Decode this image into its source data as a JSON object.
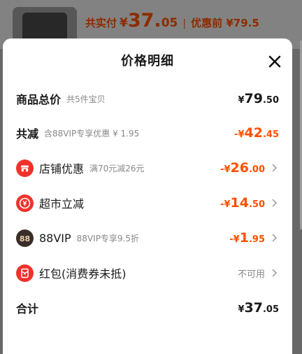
{
  "background": {
    "total_label": "共实付",
    "total_currency": "¥",
    "total_int": "37.",
    "total_dec": "05",
    "separator": "|",
    "original_label": "优惠前 ¥79.5"
  },
  "sheet": {
    "title": "价格明细",
    "close_icon": "close-icon"
  },
  "rows": [
    {
      "name": "goods-total",
      "label": "商品总价",
      "sub": "共5件宝贝",
      "prefix": "¥",
      "int": "79",
      "dec": ".50",
      "style": "black"
    },
    {
      "name": "total-discount",
      "label": "共减",
      "sub": "含88VIP专享优惠 ¥ 1.95",
      "prefix": "-¥",
      "int": "42",
      "dec": ".45",
      "style": "red"
    },
    {
      "name": "shop-discount",
      "label": "店铺优惠",
      "sub": "满70元减26元",
      "prefix": "-¥",
      "int": "26",
      "dec": ".00",
      "style": "red",
      "icon": "shop-icon"
    },
    {
      "name": "supermarket-discount",
      "label": "超市立减",
      "sub": "",
      "prefix": "-¥",
      "int": "14",
      "dec": ".50",
      "style": "red",
      "icon": "yen-icon"
    },
    {
      "name": "vip-discount",
      "label": "88VIP",
      "sub": "88VIP专享9.5折",
      "prefix": "-¥",
      "int": "1",
      "dec": ".95",
      "style": "red",
      "icon": "88vip-icon"
    },
    {
      "name": "red-packet",
      "label": "红包(消费券未抵)",
      "sub": "",
      "status": "不可用",
      "icon": "red-packet-icon"
    },
    {
      "name": "grand-total",
      "label": "合计",
      "sub": "",
      "prefix": "¥",
      "int": "37",
      "dec": ".05",
      "style": "black"
    }
  ],
  "colors": {
    "accent": "#ff5000",
    "icon_red": "#f2312b",
    "icon_dark": "#3a2e2a"
  }
}
